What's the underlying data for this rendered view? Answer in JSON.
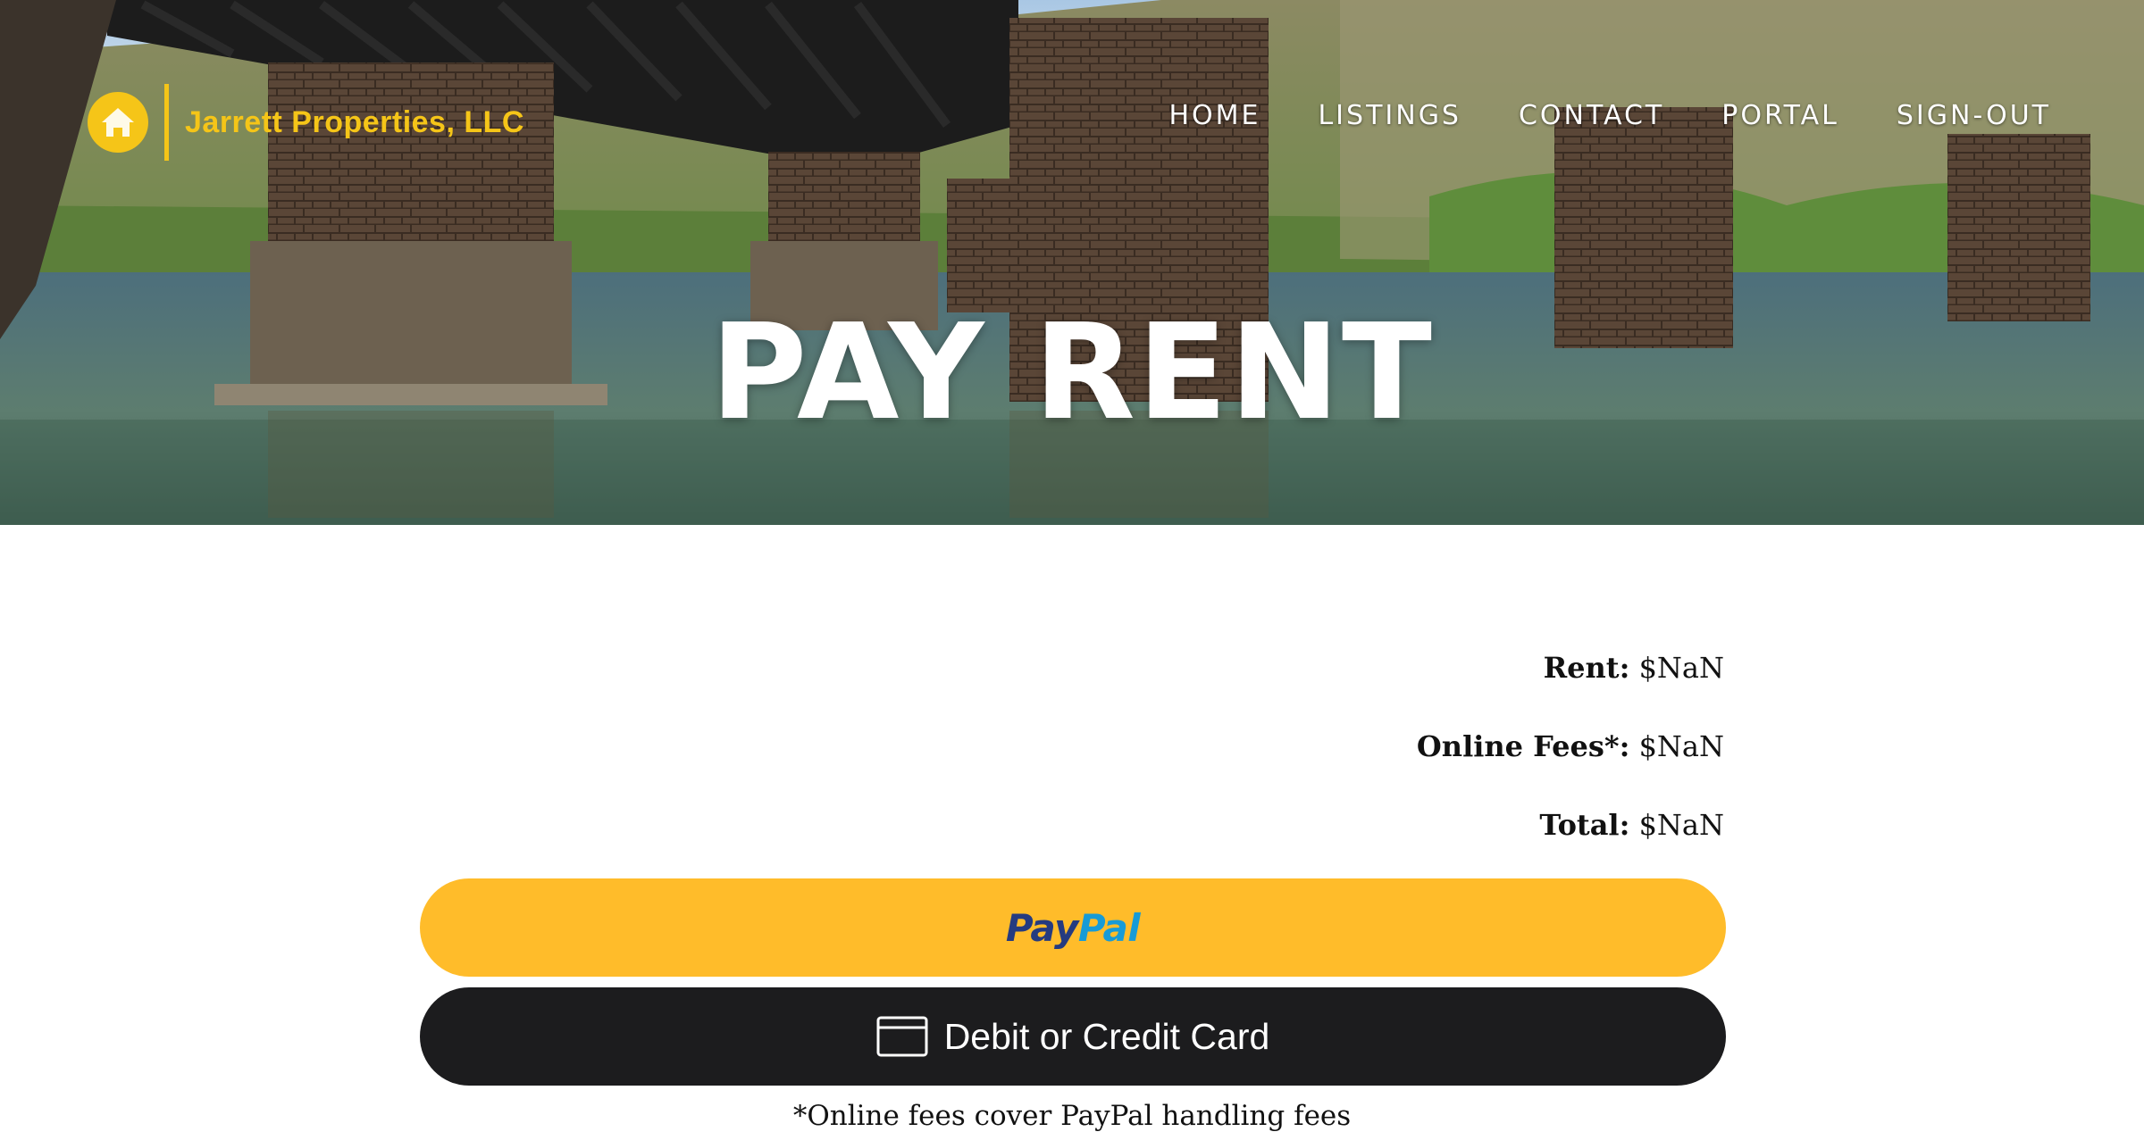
{
  "brand": {
    "name": "Jarrett Properties, LLC",
    "logo_icon": "house-icon",
    "accent_color": "#F5C518"
  },
  "nav": {
    "items": [
      {
        "label": "HOME"
      },
      {
        "label": "LISTINGS"
      },
      {
        "label": "CONTACT"
      },
      {
        "label": "PORTAL"
      },
      {
        "label": "SIGN-OUT"
      }
    ]
  },
  "hero": {
    "title": "PAY RENT",
    "background": "river-bridge-piers-photo"
  },
  "summary": {
    "rent_label": "Rent:",
    "rent_value": "$NaN",
    "fees_label": "Online Fees*:",
    "fees_value": "$NaN",
    "total_label": "Total:",
    "total_value": "$NaN"
  },
  "payment": {
    "paypal_part1": "Pay",
    "paypal_part2": "Pal",
    "paypal_color": "#FFBC2A",
    "paypal_dark": "#253B80",
    "paypal_light": "#179BD7",
    "card_label": "Debit or Credit Card",
    "card_color": "#1C1C1E",
    "card_icon": "credit-card-icon"
  },
  "footnote": "*Online fees cover PayPal handling fees"
}
